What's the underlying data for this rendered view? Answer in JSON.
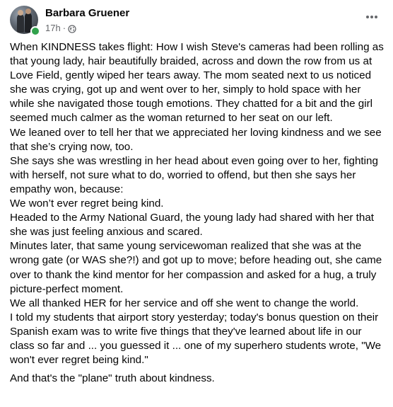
{
  "author": {
    "name": "Barbara Gruener",
    "timestamp": "17h",
    "separator": "·",
    "privacy_icon": "globe-icon",
    "online": true,
    "online_color": "#31a24c"
  },
  "more_icon": "more-horizontal-icon",
  "post": {
    "paragraphs": [
      "When KINDNESS takes flight: How I wish Steve's cameras had been rolling as that young lady, hair beautifully braided, across and down the row from us at Love Field, gently wiped her tears away. The mom seated next to us noticed she was crying, got up and went over to her, simply to hold space with her while she navigated those tough emotions. They chatted for a bit and the girl seemed much calmer as the woman returned to her seat on our left.",
      "We leaned over to tell her that we appreciated her loving kindness and we see that she’s crying now, too.",
      "She says she was wrestling in her head about even going over to her, fighting with herself, not sure what to do, worried to offend, but then she says her empathy won, because:",
      "We won’t ever regret being kind.",
      "Headed to the Army National Guard, the young lady had shared with her that she was just feeling anxious and scared.",
      "Minutes later, that same young servicewoman realized that she was at the wrong gate (or WAS she?!) and got up to move; before heading out, she came over to thank the kind mentor for her compassion and asked for a hug, a truly picture-perfect moment.",
      "We all thanked HER for her service and off she went to change the world.",
      "I told my students that airport story yesterday; today's bonus question on their Spanish exam was to write five things that they've learned about life in our class so far and ... you guessed it ... one of my superhero students wrote, \"We won't ever regret being kind.\""
    ],
    "closing": "And that's the \"plane\" truth about kindness."
  }
}
